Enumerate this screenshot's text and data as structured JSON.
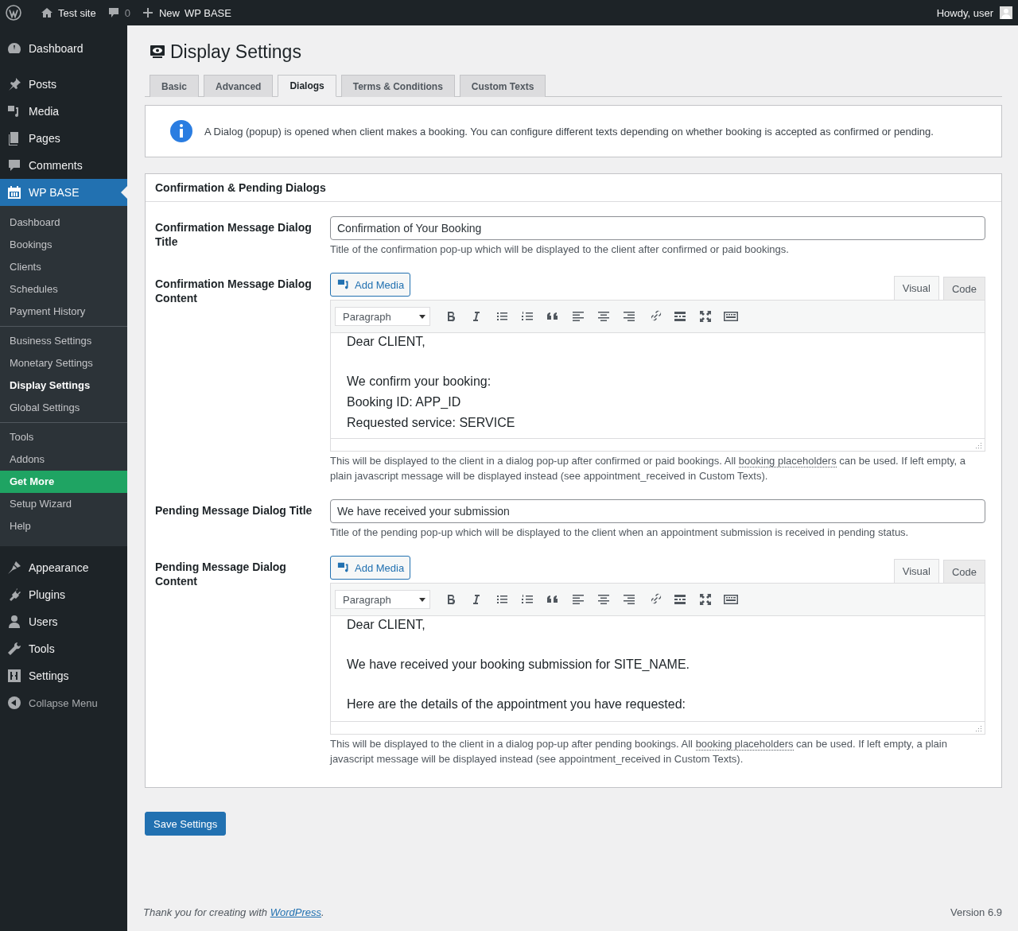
{
  "admin_bar": {
    "site": "Test site",
    "comments": "0",
    "new": "New",
    "plugin": "WP BASE",
    "greeting": "Howdy, user"
  },
  "sidebar": {
    "items": [
      {
        "label": "Dashboard",
        "selected": false
      },
      {
        "label": "Posts",
        "selected": false
      },
      {
        "label": "Media",
        "selected": false
      },
      {
        "label": "Pages",
        "selected": false
      },
      {
        "label": "Comments",
        "selected": false
      },
      {
        "label": "WP BASE",
        "selected": true,
        "submenu": [
          [
            {
              "label": "Dashboard",
              "kind": "link",
              "selected": false
            },
            {
              "label": "Bookings",
              "kind": "link",
              "selected": false
            },
            {
              "label": "Clients",
              "kind": "link",
              "selected": false
            },
            {
              "label": "Schedules",
              "kind": "link",
              "selected": false
            },
            {
              "label": "Payment History",
              "kind": "link",
              "selected": false
            }
          ],
          [
            {
              "label": "Business Settings",
              "kind": "link",
              "selected": false
            },
            {
              "label": "Monetary Settings",
              "kind": "link",
              "selected": false
            },
            {
              "label": "Display Settings",
              "kind": "link",
              "selected": true
            },
            {
              "label": "Global Settings",
              "kind": "link",
              "selected": false
            }
          ],
          [
            {
              "label": "Tools",
              "kind": "link",
              "selected": false
            },
            {
              "label": "Addons",
              "kind": "link",
              "selected": false
            },
            {
              "label": "Get More",
              "kind": "promo",
              "selected": false
            },
            {
              "label": "Setup Wizard",
              "kind": "link",
              "selected": false
            },
            {
              "label": "Help",
              "kind": "link",
              "selected": false
            }
          ]
        ]
      },
      {
        "label": "Appearance",
        "selected": false
      },
      {
        "label": "Plugins",
        "selected": false
      },
      {
        "label": "Users",
        "selected": false
      },
      {
        "label": "Tools",
        "selected": false
      },
      {
        "label": "Settings",
        "selected": false
      }
    ],
    "collapse": "Collapse Menu"
  },
  "page": {
    "title": "Display Settings",
    "tabs": [
      {
        "label": "Basic",
        "selected": false
      },
      {
        "label": "Advanced",
        "selected": false
      },
      {
        "label": "Dialogs",
        "selected": true
      },
      {
        "label": "Terms & Conditions",
        "selected": false
      },
      {
        "label": "Custom Texts",
        "selected": false
      }
    ],
    "notice": "A Dialog (popup) is opened when client makes a booking. You can configure different texts depending on whether booking is accepted as confirmed or pending.",
    "section_title": "Confirmation & Pending Dialogs",
    "settings": [
      {
        "kind": "text",
        "label": "Confirmation Message Dialog Title",
        "value": "Confirmation of Your Booking",
        "description": {
          "before": "Title of the confirmation pop-up which will be displayed to the client after confirmed or paid bookings."
        }
      },
      {
        "kind": "editor",
        "label": "Confirmation Message Dialog Content",
        "add_media": "Add Media",
        "modes": [
          {
            "label": "Visual",
            "selected": true
          },
          {
            "label": "Code",
            "selected": false
          }
        ],
        "format": "Paragraph",
        "paragraphs": [
          [
            "Dear CLIENT,"
          ],
          [
            "We confirm your booking:",
            "Booking ID: APP_ID",
            "Requested service: SERVICE"
          ]
        ],
        "description": {
          "before": "This will be displayed to the client in a dialog pop-up after confirmed or paid bookings. All",
          "link": "booking placeholders",
          "after": "can be used. If left empty, a plain javascript message will be displayed instead (see appointment_received in Custom Texts)."
        }
      },
      {
        "kind": "text",
        "label": "Pending Message Dialog Title",
        "value": "We have received your submission",
        "description": {
          "before": "Title of the pending pop-up which will be displayed to the client when an appointment submission is received in pending status."
        }
      },
      {
        "kind": "editor",
        "label": "Pending Message Dialog Content",
        "add_media": "Add Media",
        "modes": [
          {
            "label": "Visual",
            "selected": true
          },
          {
            "label": "Code",
            "selected": false
          }
        ],
        "format": "Paragraph",
        "paragraphs": [
          [
            "Dear CLIENT,"
          ],
          [
            "We have received your booking submission for SITE_NAME."
          ],
          [
            "Here are the details of the appointment you have requested:"
          ]
        ],
        "description": {
          "before": "This will be displayed to the client in a dialog pop-up after pending bookings. All",
          "link": "booking placeholders",
          "after": "can be used. If left empty, a plain javascript message will be displayed instead (see appointment_received in Custom Texts)."
        }
      }
    ],
    "save": "Save Settings"
  },
  "footer": {
    "before": "Thank you for creating with",
    "link": "WordPress",
    "after": ".",
    "version": "Version 6.9"
  }
}
